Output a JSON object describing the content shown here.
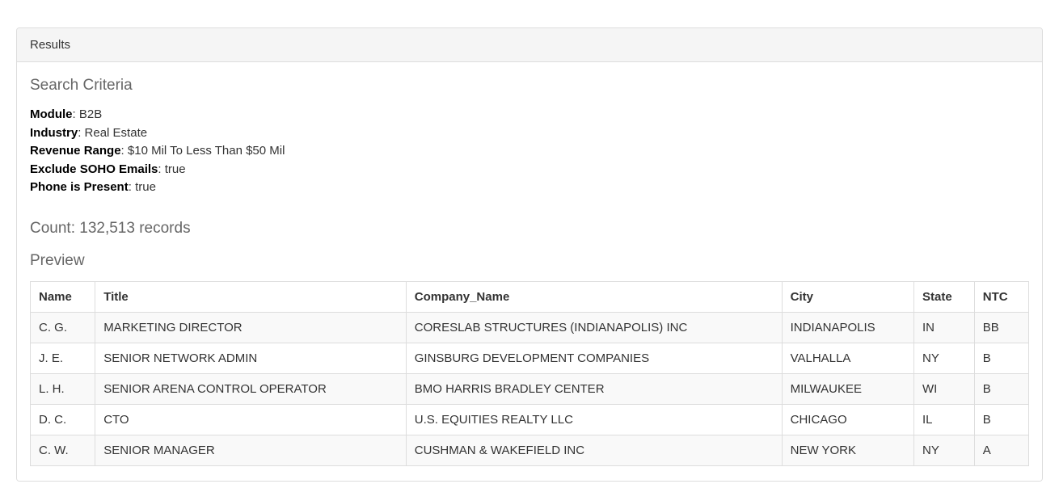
{
  "panel": {
    "title": "Results"
  },
  "search_criteria": {
    "heading": "Search Criteria",
    "items": [
      {
        "label": "Module",
        "value": "B2B"
      },
      {
        "label": "Industry",
        "value": "Real Estate"
      },
      {
        "label": "Revenue Range",
        "value": "$10 Mil To Less Than $50 Mil"
      },
      {
        "label": "Exclude SOHO Emails",
        "value": "true"
      },
      {
        "label": "Phone is Present",
        "value": "true"
      }
    ]
  },
  "count": {
    "label": "Count: 132,513 records"
  },
  "preview": {
    "heading": "Preview",
    "columns": [
      "Name",
      "Title",
      "Company_Name",
      "City",
      "State",
      "NTC"
    ],
    "rows": [
      {
        "name": "C. G.",
        "title": "MARKETING DIRECTOR",
        "company": "CORESLAB STRUCTURES (INDIANAPOLIS) INC",
        "city": "INDIANAPOLIS",
        "state": "IN",
        "ntc": "BB"
      },
      {
        "name": "J. E.",
        "title": "SENIOR NETWORK ADMIN",
        "company": "GINSBURG DEVELOPMENT COMPANIES",
        "city": "VALHALLA",
        "state": "NY",
        "ntc": "B"
      },
      {
        "name": "L. H.",
        "title": "SENIOR ARENA CONTROL OPERATOR",
        "company": "BMO HARRIS BRADLEY CENTER",
        "city": "MILWAUKEE",
        "state": "WI",
        "ntc": "B"
      },
      {
        "name": "D. C.",
        "title": "CTO",
        "company": "U.S. EQUITIES REALTY LLC",
        "city": "CHICAGO",
        "state": "IL",
        "ntc": "B"
      },
      {
        "name": "C. W.",
        "title": "SENIOR MANAGER",
        "company": "CUSHMAN & WAKEFIELD INC",
        "city": "NEW YORK",
        "state": "NY",
        "ntc": "A"
      }
    ]
  }
}
